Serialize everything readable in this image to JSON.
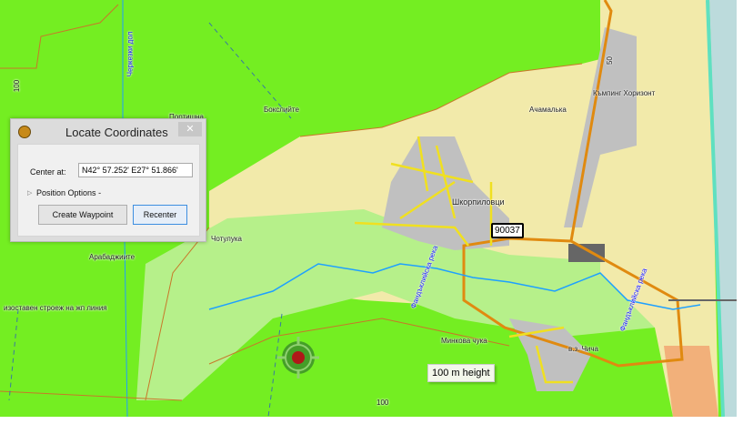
{
  "dialog": {
    "title": "Locate Coordinates",
    "close_label": "✕",
    "center_label": "Center at:",
    "center_value": "N42° 57.252' E27° 51.866'",
    "position_options": "Position Options",
    "position_options_suffix": "-",
    "create_waypoint": "Create Waypoint",
    "recenter": "Recenter"
  },
  "map": {
    "labels": {
      "cherkezki": "Черкезки дол",
      "contour_100a": "100",
      "bokliite": "Бокслийте",
      "portishna": "Портишна",
      "achamalka": "Ачамалька",
      "camping": "Къмпинг Хоризонт",
      "road_50": "50",
      "shkorpilovtsi": "Шкорпиловци",
      "chotuluka": "Чотулука",
      "arabadzhiite": "Арабаджиите",
      "abandoned": "изоставен строеж на жп линия",
      "river1": "Фандъклийска река",
      "river2": "Фандъклийска река",
      "minkova": "Минкова чука",
      "vz": "в.з. Чича",
      "contour_100b": "100"
    },
    "road_shield": "90037",
    "tooltip": "100 m height"
  },
  "colors": {
    "forest": "#74ee22",
    "urban": "#c0c0c0",
    "field": "#f2eaaa",
    "sea": "#bcdbdc",
    "road": "#e08a10",
    "street": "#f0e020"
  }
}
